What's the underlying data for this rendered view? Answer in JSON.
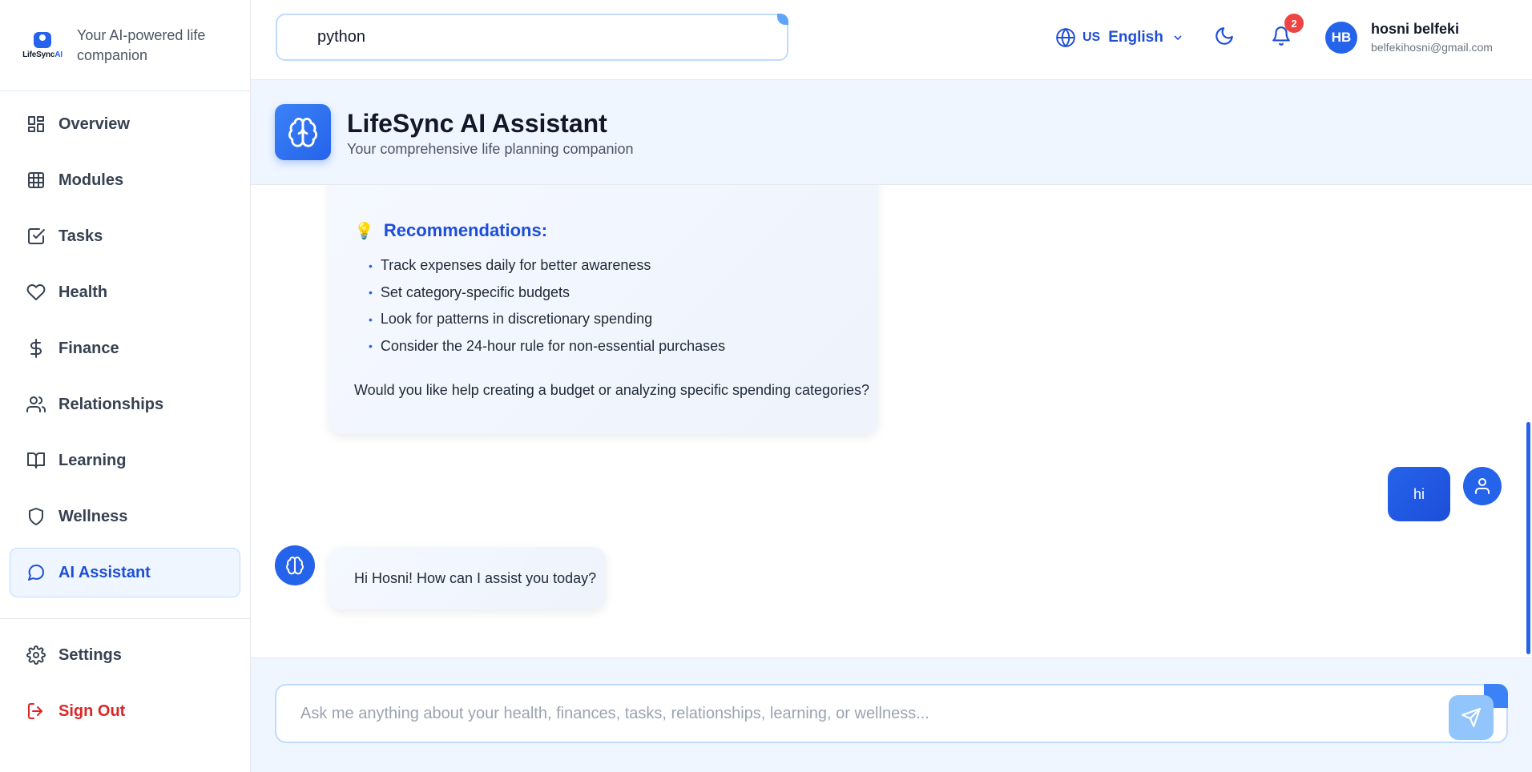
{
  "brand": {
    "logo_word_a": "LifeSync",
    "logo_word_b": "AI",
    "tagline": "Your AI-powered life companion"
  },
  "sidebar": {
    "items": [
      {
        "label": "Overview",
        "icon": "layout-dashboard-icon"
      },
      {
        "label": "Modules",
        "icon": "grid-icon"
      },
      {
        "label": "Tasks",
        "icon": "check-square-icon"
      },
      {
        "label": "Health",
        "icon": "heart-icon"
      },
      {
        "label": "Finance",
        "icon": "dollar-icon"
      },
      {
        "label": "Relationships",
        "icon": "users-icon"
      },
      {
        "label": "Learning",
        "icon": "book-icon"
      },
      {
        "label": "Wellness",
        "icon": "shield-icon"
      },
      {
        "label": "AI Assistant",
        "icon": "message-circle-icon",
        "active": true
      }
    ],
    "bottom": [
      {
        "label": "Settings",
        "icon": "gear-icon"
      },
      {
        "label": "Sign Out",
        "icon": "log-out-icon"
      }
    ]
  },
  "header": {
    "search_value": "python",
    "lang_code": "US",
    "lang_label": "English",
    "notification_count": "2",
    "user_initials": "HB",
    "user_name": "hosni belfeki",
    "user_email": "belfekihosni@gmail.com"
  },
  "assistant": {
    "title": "LifeSync AI Assistant",
    "subtitle": "Your comprehensive life planning companion"
  },
  "chat": {
    "recommendations_heading": "Recommendations:",
    "recommendations": [
      "Track expenses daily for better awareness",
      "Set category-specific budgets",
      "Look for patterns in discretionary spending",
      "Consider the 24-hour rule for non-essential purchases"
    ],
    "question": "Would you like help creating a budget or analyzing specific spending categories?",
    "user_message": "hi",
    "bot_reply": "Hi Hosni! How can I assist you today?"
  },
  "composer": {
    "placeholder": "Ask me anything about your health, finances, tasks, relationships, learning, or wellness..."
  },
  "colors": {
    "accent": "#2563eb",
    "danger": "#dc2626",
    "panel": "#eff6ff"
  }
}
